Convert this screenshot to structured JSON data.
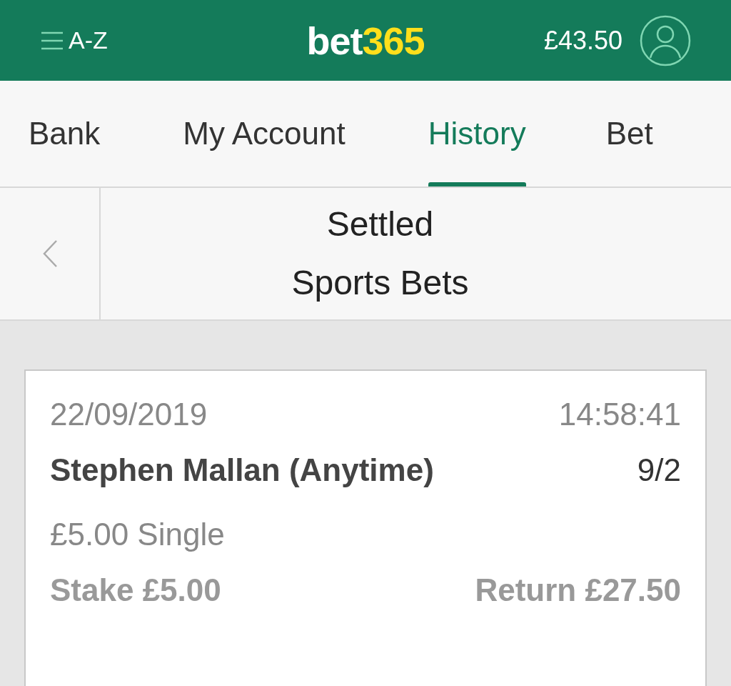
{
  "header": {
    "menu_label": "A-Z",
    "logo": [
      {
        "text": "bet",
        "color": "#ffffff"
      },
      {
        "text": "365",
        "color": "#ffdf1b"
      }
    ],
    "balance": "£43.50"
  },
  "tabs": [
    {
      "label": "Bank",
      "selected": false
    },
    {
      "label": "My Account",
      "selected": false
    },
    {
      "label": "History",
      "selected": true
    },
    {
      "label": "Bet",
      "selected": false
    }
  ],
  "subheader": {
    "title_lines": [
      "Settled",
      "Sports Bets"
    ]
  },
  "bets": [
    {
      "date": "22/09/2019",
      "time": "14:58:41",
      "selection": "Stephen Mallan (Anytime)",
      "odds": "9/2",
      "bet_type": "£5.00 Single",
      "stake": "Stake £5.00",
      "return": "Return £27.50"
    }
  ]
}
